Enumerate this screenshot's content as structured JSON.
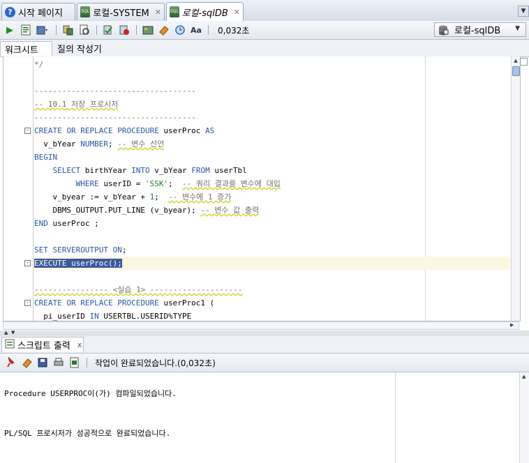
{
  "tabs": [
    {
      "label": "시작 페이지",
      "icon": "help-icon",
      "active": false
    },
    {
      "label": "로컬-SYSTEM",
      "icon": "sql-worksheet-icon",
      "active": false
    },
    {
      "label": "로컬-sqlDB",
      "icon": "sql-worksheet-icon",
      "active": true
    }
  ],
  "toolbar": {
    "timing": "0,032초",
    "connection": "로컬-sqlDB",
    "icons": [
      "run-statement-icon",
      "run-script-icon",
      "commit-dropdown-icon",
      "explain-plan-icon",
      "autotrace-icon",
      "commit-icon",
      "rollback-icon",
      "sql-tuning-icon",
      "eraser-icon",
      "history-icon",
      "format-icon"
    ]
  },
  "subtabs": {
    "worksheet": "워크시트",
    "query_builder": "질의 작성기"
  },
  "editor": {
    "lines": [
      [
        {
          "t": "*/",
          "c": "cm"
        }
      ],
      [],
      [
        {
          "t": "-----------------------------------",
          "c": "cm"
        }
      ],
      [
        {
          "t": "-- 10.1 저장 프로시저",
          "c": "cm"
        }
      ],
      [
        {
          "t": "-----------------------------------",
          "c": "cm"
        }
      ],
      [
        {
          "t": "CREATE OR REPLACE PROCEDURE",
          "c": "kw"
        },
        {
          "t": " userProc ",
          "c": ""
        },
        {
          "t": "AS",
          "c": "kw"
        }
      ],
      [
        {
          "t": "  v_bYear ",
          "c": ""
        },
        {
          "t": "NUMBER",
          "c": "kw"
        },
        {
          "t": "; ",
          "c": ""
        },
        {
          "t": "-- 변수 선언",
          "c": "cm"
        }
      ],
      [
        {
          "t": "BEGIN",
          "c": "kw"
        }
      ],
      [
        {
          "t": "    ",
          "c": ""
        },
        {
          "t": "SELECT",
          "c": "kw"
        },
        {
          "t": " birthYear ",
          "c": ""
        },
        {
          "t": "INTO",
          "c": "kw"
        },
        {
          "t": " v_bYear ",
          "c": ""
        },
        {
          "t": "FROM",
          "c": "kw"
        },
        {
          "t": " userTbl",
          "c": ""
        }
      ],
      [
        {
          "t": "         ",
          "c": ""
        },
        {
          "t": "WHERE",
          "c": "kw"
        },
        {
          "t": " userID = ",
          "c": ""
        },
        {
          "t": "'SSK'",
          "c": "str"
        },
        {
          "t": ";  ",
          "c": ""
        },
        {
          "t": "-- 쿼리 결과를 변수에 대입",
          "c": "cm"
        }
      ],
      [
        {
          "t": "    v_byear := v_bYear + ",
          "c": ""
        },
        {
          "t": "1",
          "c": "str"
        },
        {
          "t": ";  ",
          "c": ""
        },
        {
          "t": "-- 변수에 1 증가",
          "c": "cm"
        }
      ],
      [
        {
          "t": "    DBMS_OUTPUT.PUT_LINE (v_byear); ",
          "c": ""
        },
        {
          "t": "-- 변수 값 출력",
          "c": "cm"
        }
      ],
      [
        {
          "t": "END",
          "c": "kw"
        },
        {
          "t": " userProc ;",
          "c": ""
        }
      ],
      [],
      [
        {
          "t": "SET SERVEROUTPUT ON",
          "c": "kw"
        },
        {
          "t": ";",
          "c": ""
        }
      ],
      [
        {
          "t": "EXECUTE userProc();",
          "c": "sel"
        }
      ],
      [],
      [
        {
          "t": "---------------- <실습 1> --------------------",
          "c": "cm"
        }
      ],
      [
        {
          "t": "CREATE OR REPLACE PROCEDURE",
          "c": "kw"
        },
        {
          "t": " userProc1 (",
          "c": ""
        }
      ],
      [
        {
          "t": "  pi_userID ",
          "c": ""
        },
        {
          "t": "IN",
          "c": "kw"
        },
        {
          "t": " USERTBL.USERID%TYPE",
          "c": ""
        }
      ]
    ],
    "folds": [
      5,
      15,
      18
    ]
  },
  "output": {
    "tab_label": "스크립트 출력",
    "status": "작업이 완료되었습니다.(0,032초)",
    "lines": [
      "Procedure USERPROC이(가) 컴파일되었습니다.",
      "PL/SQL 프로시저가 성공적으로 완료되었습니다."
    ],
    "icons": [
      "pin-icon",
      "eraser-icon",
      "save-icon",
      "print-icon",
      "export-icon"
    ]
  }
}
